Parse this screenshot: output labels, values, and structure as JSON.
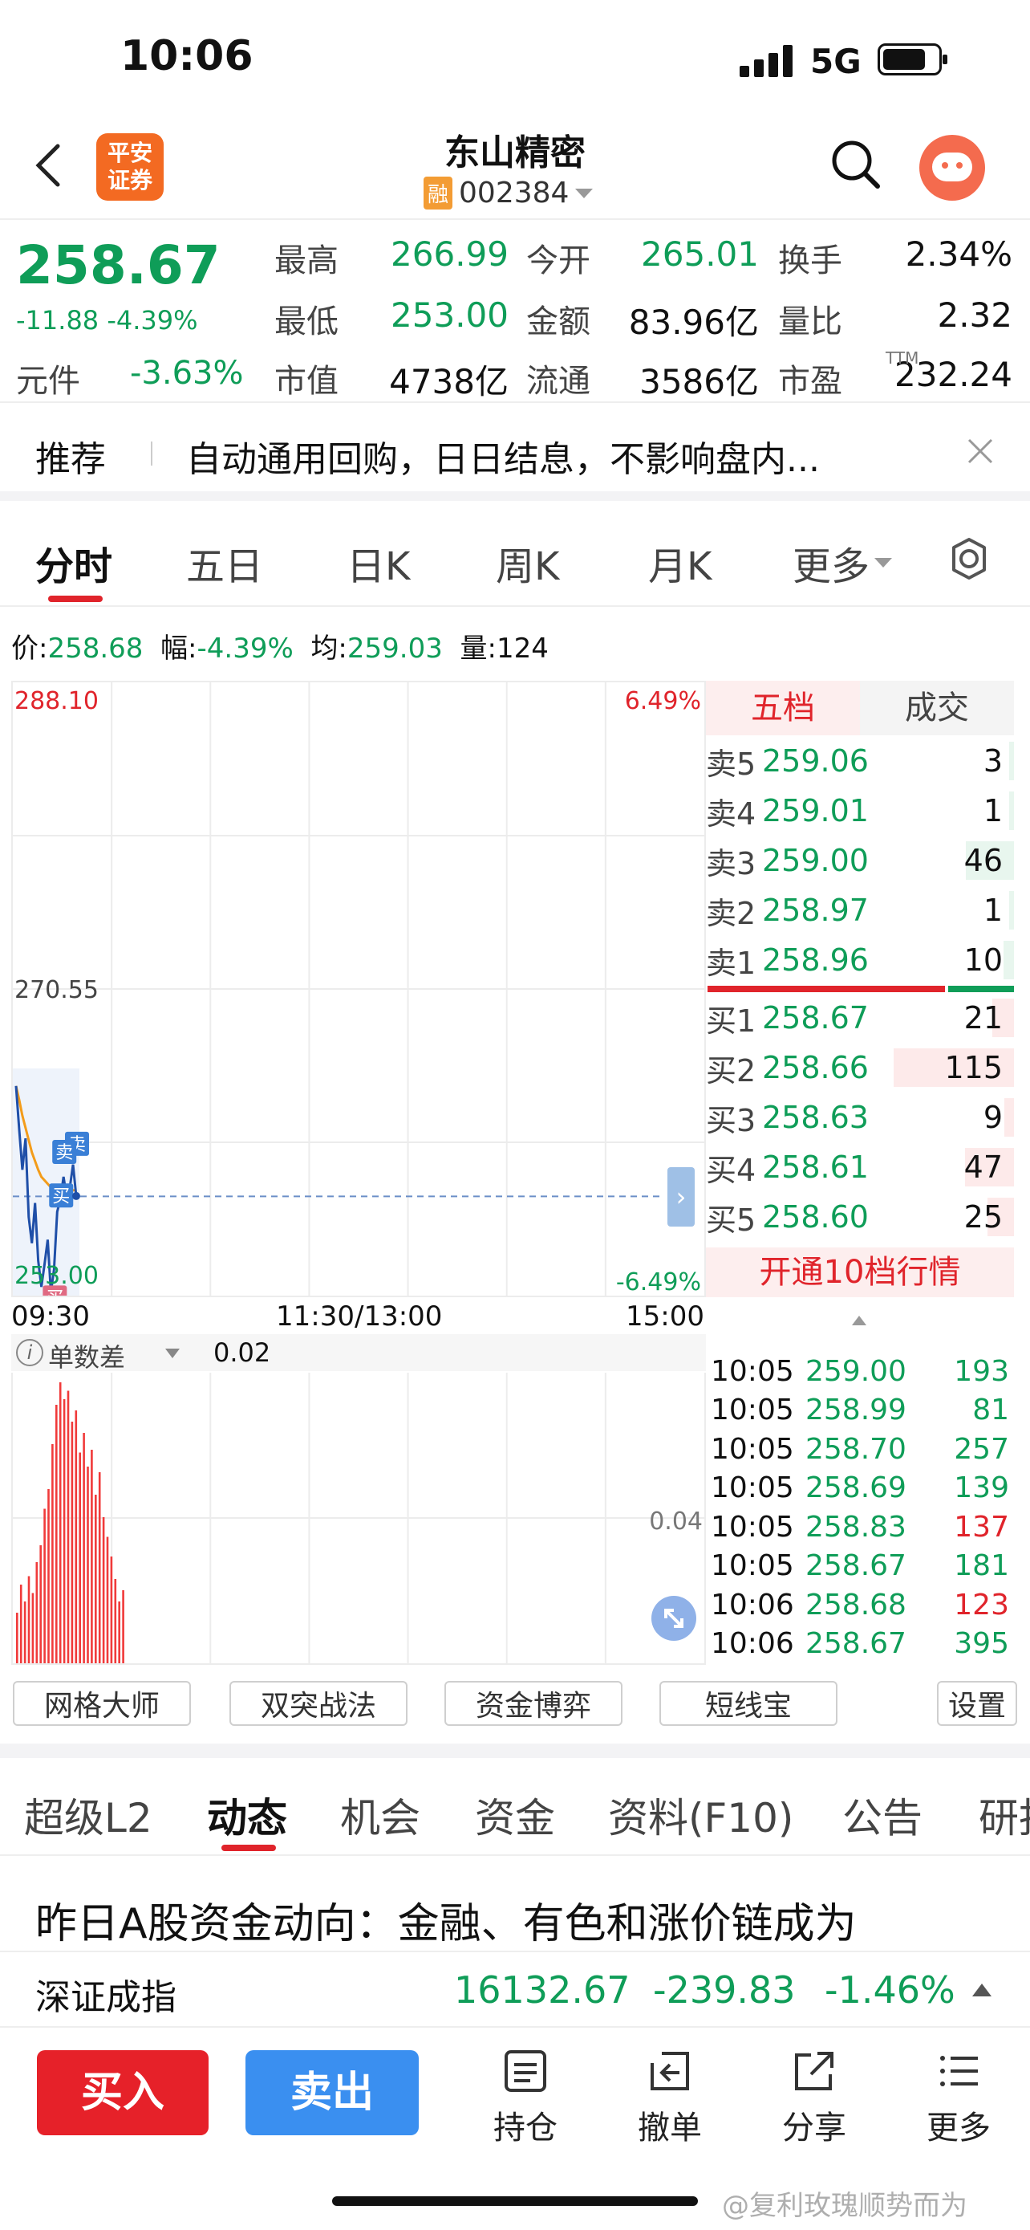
{
  "status_bar": {
    "time": "10:06",
    "network": "5G"
  },
  "header": {
    "logo_line1": "平安",
    "logo_line2": "证券",
    "stock_name": "东山精密",
    "margin_tag": "融",
    "stock_code": "002384"
  },
  "quote": {
    "price": "258.67",
    "change": "-11.88",
    "change_pct": "-4.39%",
    "unit_label": "元件",
    "unit_value": "-3.63%",
    "fields": [
      {
        "label": "最高",
        "value": "266.99"
      },
      {
        "label": "今开",
        "value": "265.01"
      },
      {
        "label": "换手",
        "value": "2.34%"
      },
      {
        "label": "最低",
        "value": "253.00"
      },
      {
        "label": "金额",
        "value": "83.96亿"
      },
      {
        "label": "量比",
        "value": "2.32"
      },
      {
        "label": "市值",
        "value": "4738亿"
      },
      {
        "label": "流通",
        "value": "3586亿"
      },
      {
        "label": "市盈",
        "value": "232.24",
        "sup": "TTM"
      }
    ]
  },
  "promo": {
    "tag": "推荐",
    "text": "自动通用回购，日日结息，不影响盘内..."
  },
  "chart_tabs": [
    "分时",
    "五日",
    "日K",
    "周K",
    "月K",
    "更多"
  ],
  "info_line": {
    "price_label": "价:",
    "price": "258.68",
    "amp_label": "幅:",
    "amp": "-4.39%",
    "avg_label": "均:",
    "avg": "259.03",
    "vol_label": "量:",
    "vol": "124"
  },
  "chart_data": {
    "type": "line",
    "y_ticks": {
      "top": "288.10",
      "mid": "270.55",
      "bottom": "253.00"
    },
    "pct_ticks": {
      "top": "6.49%",
      "bottom": "-6.49%"
    },
    "x_ticks": [
      "09:30",
      "11:30/13:00",
      "15:00"
    ],
    "ylim": [
      253.0,
      288.1
    ],
    "prev_close": 270.55,
    "price_series": [
      265.0,
      262.5,
      260.2,
      262.0,
      257.5,
      256.0,
      258.3,
      255.0,
      253.5,
      254.8,
      256.2,
      253.2,
      254.5,
      257.8,
      258.5,
      259.8,
      258.6,
      259.2,
      260.5,
      258.7
    ],
    "avg_series": [
      265.0,
      264.2,
      263.3,
      262.6,
      261.9,
      261.2,
      260.7,
      260.2,
      259.8,
      259.6,
      259.4,
      259.2,
      259.1,
      259.05,
      259.03,
      259.03,
      259.03,
      259.03,
      259.03,
      259.03
    ],
    "markers": [
      "卖",
      "卖",
      "买",
      "买"
    ],
    "sub_indicator": {
      "name": "单数差",
      "value": "0.02",
      "scale_label": "0.04"
    },
    "sub_bars": [
      0.18,
      0.28,
      0.22,
      0.31,
      0.25,
      0.36,
      0.42,
      0.55,
      0.62,
      0.78,
      0.92,
      1.0,
      0.94,
      0.97,
      0.86,
      0.9,
      0.75,
      0.82,
      0.7,
      0.76,
      0.6,
      0.68,
      0.52,
      0.45,
      0.38,
      0.3,
      0.22,
      0.26
    ]
  },
  "order_book": {
    "tabs": [
      "五档",
      "成交"
    ],
    "asks": [
      {
        "label": "卖5",
        "price": "259.06",
        "vol": "3",
        "bar": 0.03
      },
      {
        "label": "卖4",
        "price": "259.01",
        "vol": "1",
        "bar": 0.01
      },
      {
        "label": "卖3",
        "price": "259.00",
        "vol": "46",
        "bar": 0.4
      },
      {
        "label": "卖2",
        "price": "258.97",
        "vol": "1",
        "bar": 0.01
      },
      {
        "label": "卖1",
        "price": "258.96",
        "vol": "10",
        "bar": 0.09
      }
    ],
    "bids": [
      {
        "label": "买1",
        "price": "258.67",
        "vol": "21",
        "bar": 0.18
      },
      {
        "label": "买2",
        "price": "258.66",
        "vol": "115",
        "bar": 1.0
      },
      {
        "label": "买3",
        "price": "258.63",
        "vol": "9",
        "bar": 0.08
      },
      {
        "label": "买4",
        "price": "258.61",
        "vol": "47",
        "bar": 0.41
      },
      {
        "label": "买5",
        "price": "258.60",
        "vol": "25",
        "bar": 0.22
      }
    ],
    "upgrade": "开通10档行情"
  },
  "ticks": [
    {
      "time": "10:05",
      "price": "259.00",
      "vol": "193",
      "dir": "g"
    },
    {
      "time": "10:05",
      "price": "258.99",
      "vol": "81",
      "dir": "g"
    },
    {
      "time": "10:05",
      "price": "258.70",
      "vol": "257",
      "dir": "g"
    },
    {
      "time": "10:05",
      "price": "258.69",
      "vol": "139",
      "dir": "g"
    },
    {
      "time": "10:05",
      "price": "258.83",
      "vol": "137",
      "dir": "r"
    },
    {
      "time": "10:05",
      "price": "258.67",
      "vol": "181",
      "dir": "g"
    },
    {
      "time": "10:06",
      "price": "258.68",
      "vol": "123",
      "dir": "r"
    },
    {
      "time": "10:06",
      "price": "258.67",
      "vol": "395",
      "dir": "g"
    }
  ],
  "tools": [
    "网格大师",
    "双突战法",
    "资金博弈",
    "短线宝",
    "设置"
  ],
  "section_tabs": [
    "超级L2",
    "动态",
    "机会",
    "资金",
    "资料(F10)",
    "公告",
    "研报"
  ],
  "news_headline": "昨日A股资金动向：金融、有色和涨价链成为",
  "index_bar": {
    "name": "深证成指",
    "value": "16132.67",
    "change": "-239.83",
    "pct": "-1.46%"
  },
  "actions": {
    "buy": "买入",
    "sell": "卖出",
    "items": [
      "持仓",
      "撤单",
      "分享",
      "更多"
    ]
  },
  "watermark": "@复利玫瑰顺势而为",
  "colors": {
    "green": "#0f9d58",
    "red": "#e0242b",
    "blue": "#3a8ff0"
  }
}
